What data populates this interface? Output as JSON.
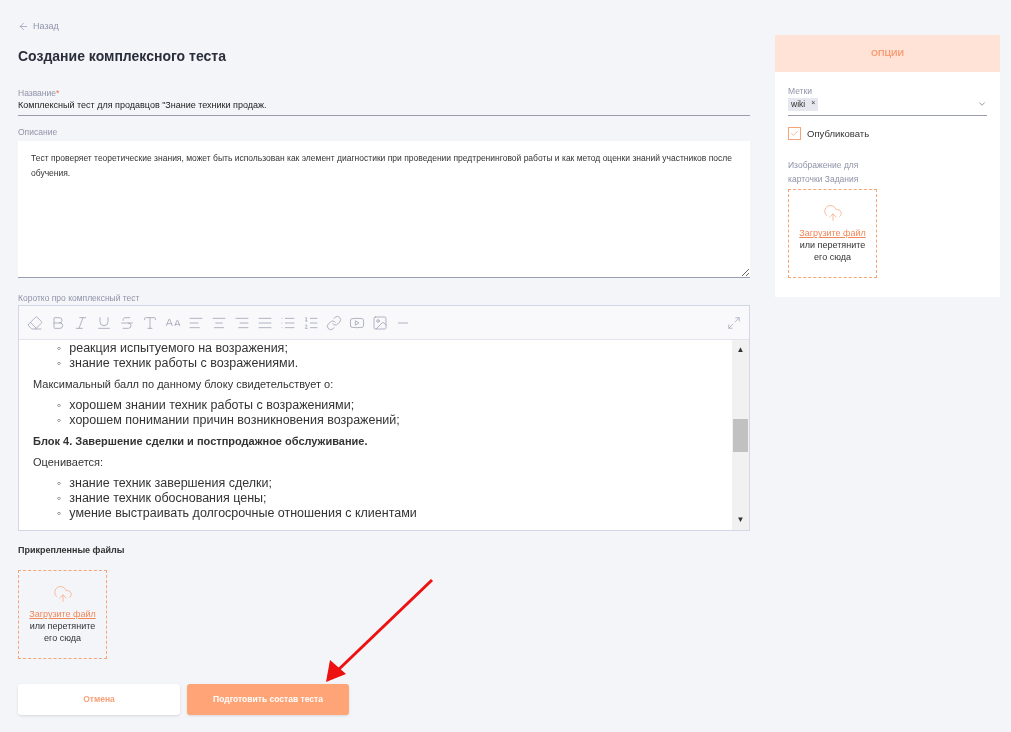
{
  "back_link": "Назад",
  "title": "Создание комплексного теста",
  "name_field": {
    "label": "Название",
    "required": true,
    "required_mark": "*",
    "value": "Комплексный тест для продавцов \"Знание техники продаж."
  },
  "description": {
    "label": "Описание",
    "value": "Тест проверяет теоретические знания, может быть использован как элемент диагностики при проведении предтренинговой работы и как метод оценки знаний участников после обучения."
  },
  "short_about": {
    "label": "Коротко про комплексный тест",
    "list_marker": "◦",
    "scroll_up": "▲",
    "scroll_down": "▼",
    "blocks": [
      {
        "kind": "list",
        "items": [
          "реакция испытуемого на возражения;",
          "знание техник работы с возражениями."
        ]
      },
      {
        "kind": "paragraph",
        "text": "Максимальный балл по данному блоку свидетельствует о:"
      },
      {
        "kind": "list",
        "items": [
          "хорошем знании техник работы с возражениями;",
          "хорошем понимании причин возникновения возражений;"
        ]
      },
      {
        "kind": "heading",
        "text": "Блок 4. Завершение сделки и постпродажное обслуживание."
      },
      {
        "kind": "paragraph",
        "text": "Оценивается:"
      },
      {
        "kind": "list",
        "items": [
          "знание техник завершения сделки;",
          "знание техник обоснования цены;",
          "умение выстраивать долгосрочные отношения с клиентами"
        ]
      }
    ]
  },
  "attachments": {
    "label": "Прикрепленные файлы",
    "upload_link": "Загрузите файл",
    "upload_hint": "или перетяните его сюда"
  },
  "buttons": [
    {
      "label": "Отмена",
      "kind": "secondary"
    },
    {
      "label": "Подготовить состав теста",
      "kind": "primary"
    }
  ],
  "options": {
    "title": "ОПЦИИ",
    "tags_label": "Метки",
    "tags": [
      {
        "label": "wiki",
        "remove": "×"
      }
    ],
    "publish": {
      "label": "Опубликовать",
      "checked": true
    },
    "image_label": "Изображение для карточки Задания",
    "upload_link": "Загрузите файл",
    "upload_hint": "или перетяните его сюда"
  }
}
